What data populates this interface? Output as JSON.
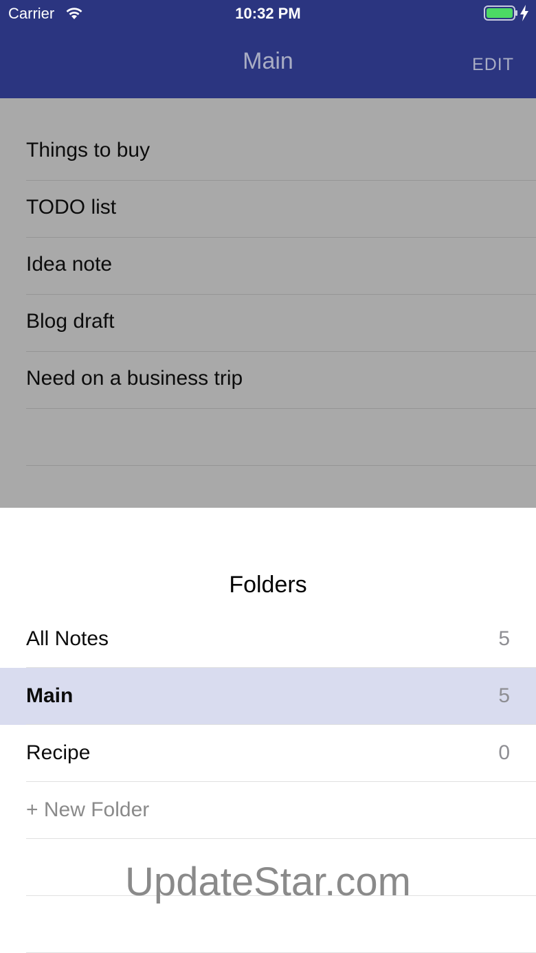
{
  "status_bar": {
    "carrier": "Carrier",
    "time": "10:32 PM",
    "battery_color": "#4cd964"
  },
  "nav": {
    "title": "Main",
    "edit_label": "EDIT",
    "bar_color": "#2b3580"
  },
  "notes": [
    {
      "title": "Things to buy"
    },
    {
      "title": "TODO list"
    },
    {
      "title": "Idea note"
    },
    {
      "title": "Blog draft"
    },
    {
      "title": "Need on a business trip"
    }
  ],
  "folders": {
    "title": "Folders",
    "items": [
      {
        "label": "All Notes",
        "count": "5"
      },
      {
        "label": "Main",
        "count": "5"
      },
      {
        "label": "Recipe",
        "count": "0"
      }
    ],
    "new_folder_label": "+ New Folder",
    "selected_color": "#d9dcef"
  },
  "watermark": "UpdateStar.com"
}
